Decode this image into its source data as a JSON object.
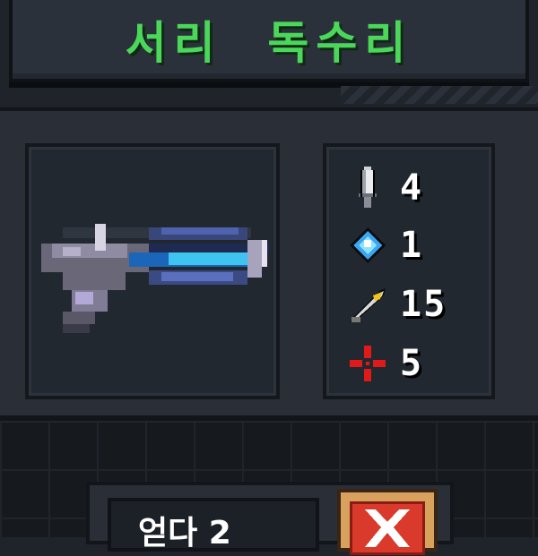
{
  "title": "서리  독수리",
  "weapon": {
    "icon": "ice-blaster-gun-sprite"
  },
  "stats": [
    {
      "icon": "sword-icon",
      "value": "4"
    },
    {
      "icon": "energy-crystal-icon",
      "value": "1"
    },
    {
      "icon": "feather-icon",
      "value": "15"
    },
    {
      "icon": "crosshair-icon",
      "value": "5"
    }
  ],
  "price": {
    "label": "얻다 2"
  },
  "close": {
    "icon": "close-x-icon"
  },
  "colors": {
    "title": "#4bd85a",
    "panel": "#2a2f37",
    "close_bg": "#d93a2c"
  }
}
